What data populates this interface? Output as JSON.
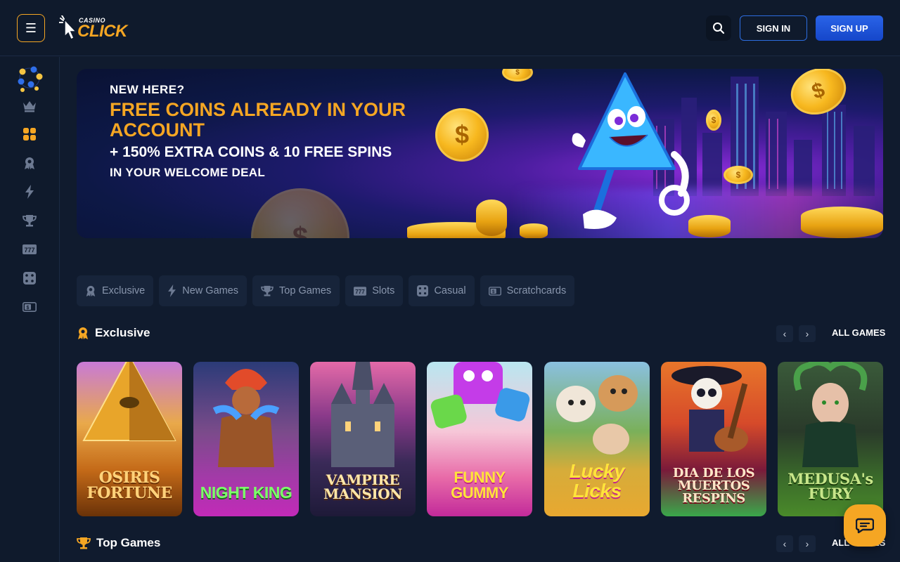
{
  "header": {
    "logo_small": "CASINO",
    "logo_big": "CLICK",
    "sign_in": "SIGN IN",
    "sign_up": "SIGN UP"
  },
  "sidebar": {
    "items": [
      {
        "icon": "avatars-icon"
      },
      {
        "icon": "crown-icon"
      },
      {
        "icon": "grid-icon"
      },
      {
        "icon": "award-icon"
      },
      {
        "icon": "lightning-icon"
      },
      {
        "icon": "trophy-icon"
      },
      {
        "icon": "slots-icon"
      },
      {
        "icon": "dice-icon"
      },
      {
        "icon": "scratchcard-icon"
      }
    ]
  },
  "banner": {
    "line1": "NEW HERE?",
    "line2": "FREE COINS ALREADY IN YOUR ACCOUNT",
    "line3": "+ 150% EXTRA COINS & 10 FREE SPINS",
    "line4": "IN YOUR WELCOME DEAL"
  },
  "categories": [
    {
      "label": "Exclusive",
      "icon": "award-icon"
    },
    {
      "label": "New Games",
      "icon": "lightning-icon"
    },
    {
      "label": "Top Games",
      "icon": "trophy-icon"
    },
    {
      "label": "Slots",
      "icon": "slots-icon"
    },
    {
      "label": "Casual",
      "icon": "dice-icon"
    },
    {
      "label": "Scratchcards",
      "icon": "scratchcard-icon"
    }
  ],
  "sections": {
    "exclusive": {
      "title": "Exclusive",
      "all": "ALL GAMES"
    },
    "top": {
      "title": "Top Games",
      "all": "ALL GAMES"
    }
  },
  "games": [
    {
      "title": "OSIRIS FORTUNE"
    },
    {
      "title": "NIGHT KING"
    },
    {
      "title": "VAMPIRE MANSION"
    },
    {
      "title": "FUNNY GUMMY"
    },
    {
      "title": "Lucky Licks"
    },
    {
      "title": "DIA DE LOS MUERTOS RESPINS"
    },
    {
      "title": "MEDUSA's FURY"
    }
  ],
  "colors": {
    "accent": "#f5a623",
    "primary_blue": "#1f5ae0",
    "background": "#101b2e"
  }
}
